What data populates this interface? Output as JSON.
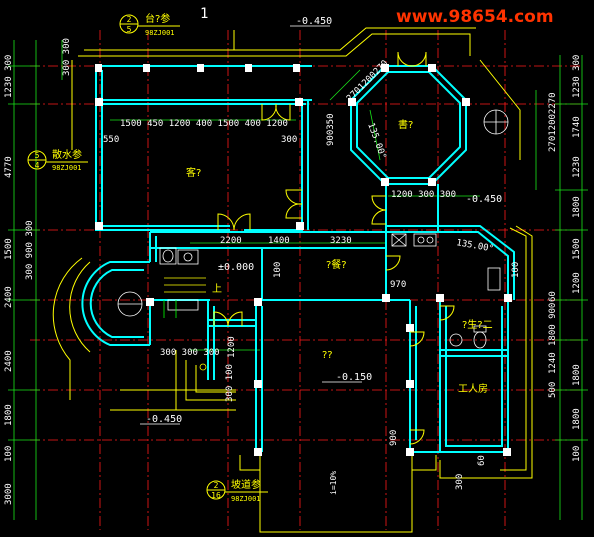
{
  "watermark": "www.98654.com",
  "dims_left": [
    "300 300",
    "1230 300",
    "4770",
    "1500",
    "300 900 300",
    "2400",
    "2400",
    "1800",
    "100",
    "3000"
  ],
  "dims_right": [
    "1230 300",
    "27012002270",
    "1740",
    "1230",
    "1800",
    "1500",
    "1200",
    "60",
    "1800 900",
    "1800",
    "1800",
    "100"
  ],
  "dims_inner": {
    "row1": "1500  450 1200 400  1500  400 1200",
    "d550": "550",
    "d300a": "300",
    "d900350": "900350",
    "d2701": "2701200270",
    "d135a": "135.00°",
    "d135b": "135.00°",
    "d1200300": "1200 300  300",
    "d2200": "2200",
    "d1400": "1400",
    "d3230": "3230",
    "d970": "970",
    "d100a": "100",
    "d100b": "100",
    "d300300": "300 300 300",
    "d1200": "1200",
    "d300100": "300 100",
    "d900": "900",
    "d300b": "300",
    "d500": "500",
    "d1240": "1240",
    "d60": "60"
  },
  "levels": {
    "top": "-0.450",
    "right": "-0.450",
    "mid": "±0.000",
    "center": "-0.150",
    "left": "-0.450"
  },
  "rooms": {
    "living": "客?",
    "octagon": "書?",
    "dining": "?餐?",
    "hall": "??",
    "bath": "?生?二",
    "worker": "工人房",
    "up": "上"
  },
  "detail_marks": [
    {
      "top": "2",
      "bottom": "5",
      "label": "台?参",
      "ref": "98ZJ001"
    },
    {
      "top": "5",
      "bottom": "4",
      "label": "散水参",
      "ref": "98ZJ001"
    },
    {
      "top": "2",
      "bottom": "16",
      "label": "坡道参",
      "ref": "98ZJ001"
    }
  ],
  "axis_mark": "1",
  "ramp_note": "i=10%",
  "colors": {
    "background": "#000000",
    "wall": "#00ffff",
    "line": "#ffff00",
    "axis": "#ff0000",
    "dim": "#00ff00",
    "text": "#ffffff",
    "watermark": "#ff3300"
  }
}
